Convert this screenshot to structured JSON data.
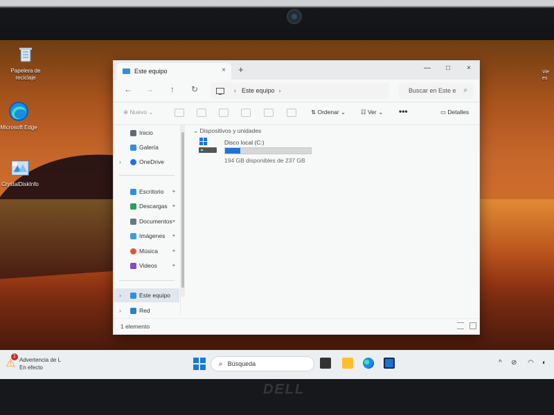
{
  "desktop": {
    "icons": [
      {
        "label": "Papelera de reciclaje",
        "icon": "recycle-bin-icon"
      },
      {
        "label": "Microsoft Edge",
        "icon": "edge-icon"
      },
      {
        "label": "CrystalDiskInfo",
        "icon": "crystaldiskinfo-icon"
      }
    ],
    "right_edge_text": "Vie\nes"
  },
  "explorer": {
    "tab_title": "Este equipo",
    "new_tab_symbol": "+",
    "address": {
      "chevron_after_pc": "›",
      "location": "Este equipo",
      "trailing_chevron": "›"
    },
    "search_placeholder": "Buscar en Este e",
    "toolbar": {
      "new_label": "Nuevo",
      "sort_label": "Ordenar",
      "view_label": "Ver",
      "more_label": "•••",
      "details_label": "Detalles"
    },
    "sidebar": {
      "items": [
        {
          "label": "Inicio",
          "icon": "home-icon"
        },
        {
          "label": "Galería",
          "icon": "gallery-icon"
        },
        {
          "label": "OneDrive",
          "icon": "onedrive-icon"
        },
        {
          "label": "Escritorio",
          "icon": "desktop-icon"
        },
        {
          "label": "Descargas",
          "icon": "downloads-icon"
        },
        {
          "label": "Documentos",
          "icon": "documents-icon"
        },
        {
          "label": "Imágenes",
          "icon": "pictures-icon"
        },
        {
          "label": "Música",
          "icon": "music-icon"
        },
        {
          "label": "Videos",
          "icon": "videos-icon"
        },
        {
          "label": "Este equipo",
          "icon": "pc-icon"
        },
        {
          "label": "Red",
          "icon": "network-icon"
        }
      ]
    },
    "main": {
      "section_header": "Dispositivos y unidades",
      "drive": {
        "name": "Disco local (C:)",
        "usage_fraction": 0.18,
        "free_text": "194 GB disponibles de 237 GB"
      }
    },
    "status": {
      "count": "1 elemento"
    }
  },
  "taskbar": {
    "notification": {
      "title": "Advertencia de L",
      "subtitle": "En efecto",
      "badge_count": "1"
    },
    "search_placeholder": "Búsqueda",
    "tray": {
      "chevron": "^"
    }
  },
  "brand": {
    "laptop_logo": "DELL"
  },
  "colors": {
    "accent": "#1d74d8",
    "taskbar": "#eceff1",
    "window": "#f7f8f8"
  }
}
